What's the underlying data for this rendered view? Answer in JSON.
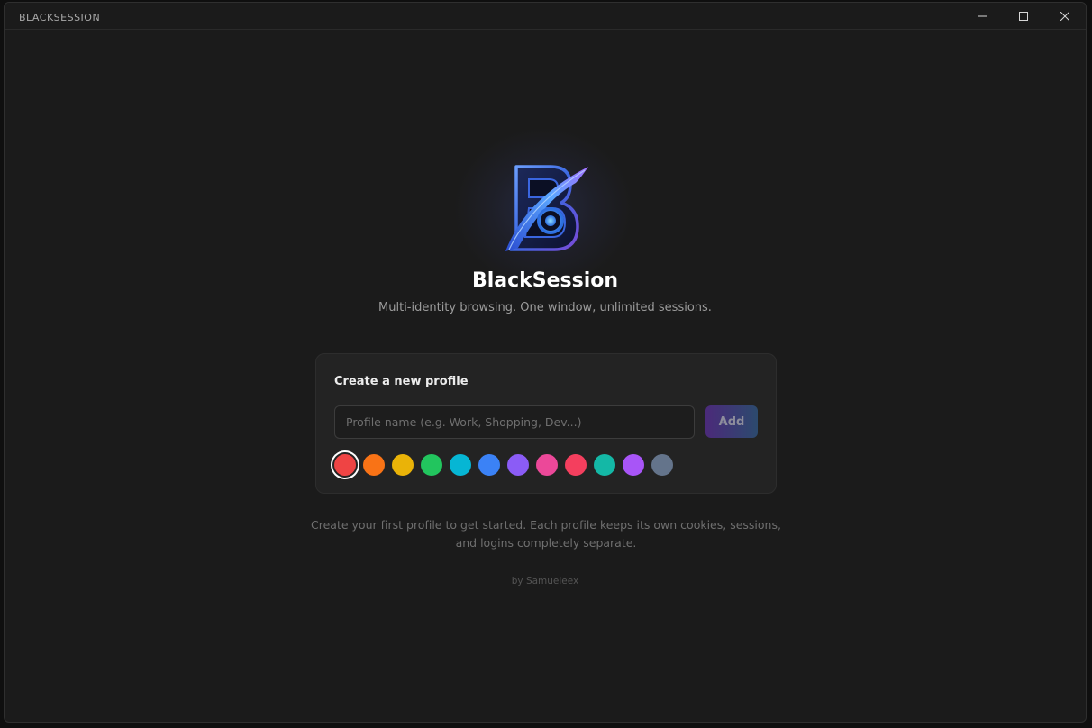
{
  "window": {
    "title": "BLACKSESSION",
    "controls": {
      "minimize": "minimize-icon",
      "maximize": "maximize-icon",
      "close": "close-icon"
    }
  },
  "brand": {
    "name": "BlackSession",
    "tagline": "Multi-identity browsing. One window, unlimited sessions.",
    "logo_icon": "blacksession-logo"
  },
  "create_profile": {
    "heading": "Create a new profile",
    "input_value": "",
    "input_placeholder": "Profile name (e.g. Work, Shopping, Dev...)",
    "add_label": "Add",
    "selected_color_index": 0,
    "colors": [
      "#ef4444",
      "#f97316",
      "#eab308",
      "#22c55e",
      "#06b6d4",
      "#3b82f6",
      "#8b5cf6",
      "#ec4899",
      "#f43f5e",
      "#14b8a6",
      "#a855f7",
      "#64748b"
    ]
  },
  "hint": "Create your first profile to get started. Each profile keeps its own cookies, sessions, and logins completely separate.",
  "credit": "by Samueleex",
  "theme": {
    "background": "#1b1b1b",
    "card": "#232323",
    "accent_gradient_start": "#4b2a7a",
    "accent_gradient_end": "#2c4a6e"
  }
}
